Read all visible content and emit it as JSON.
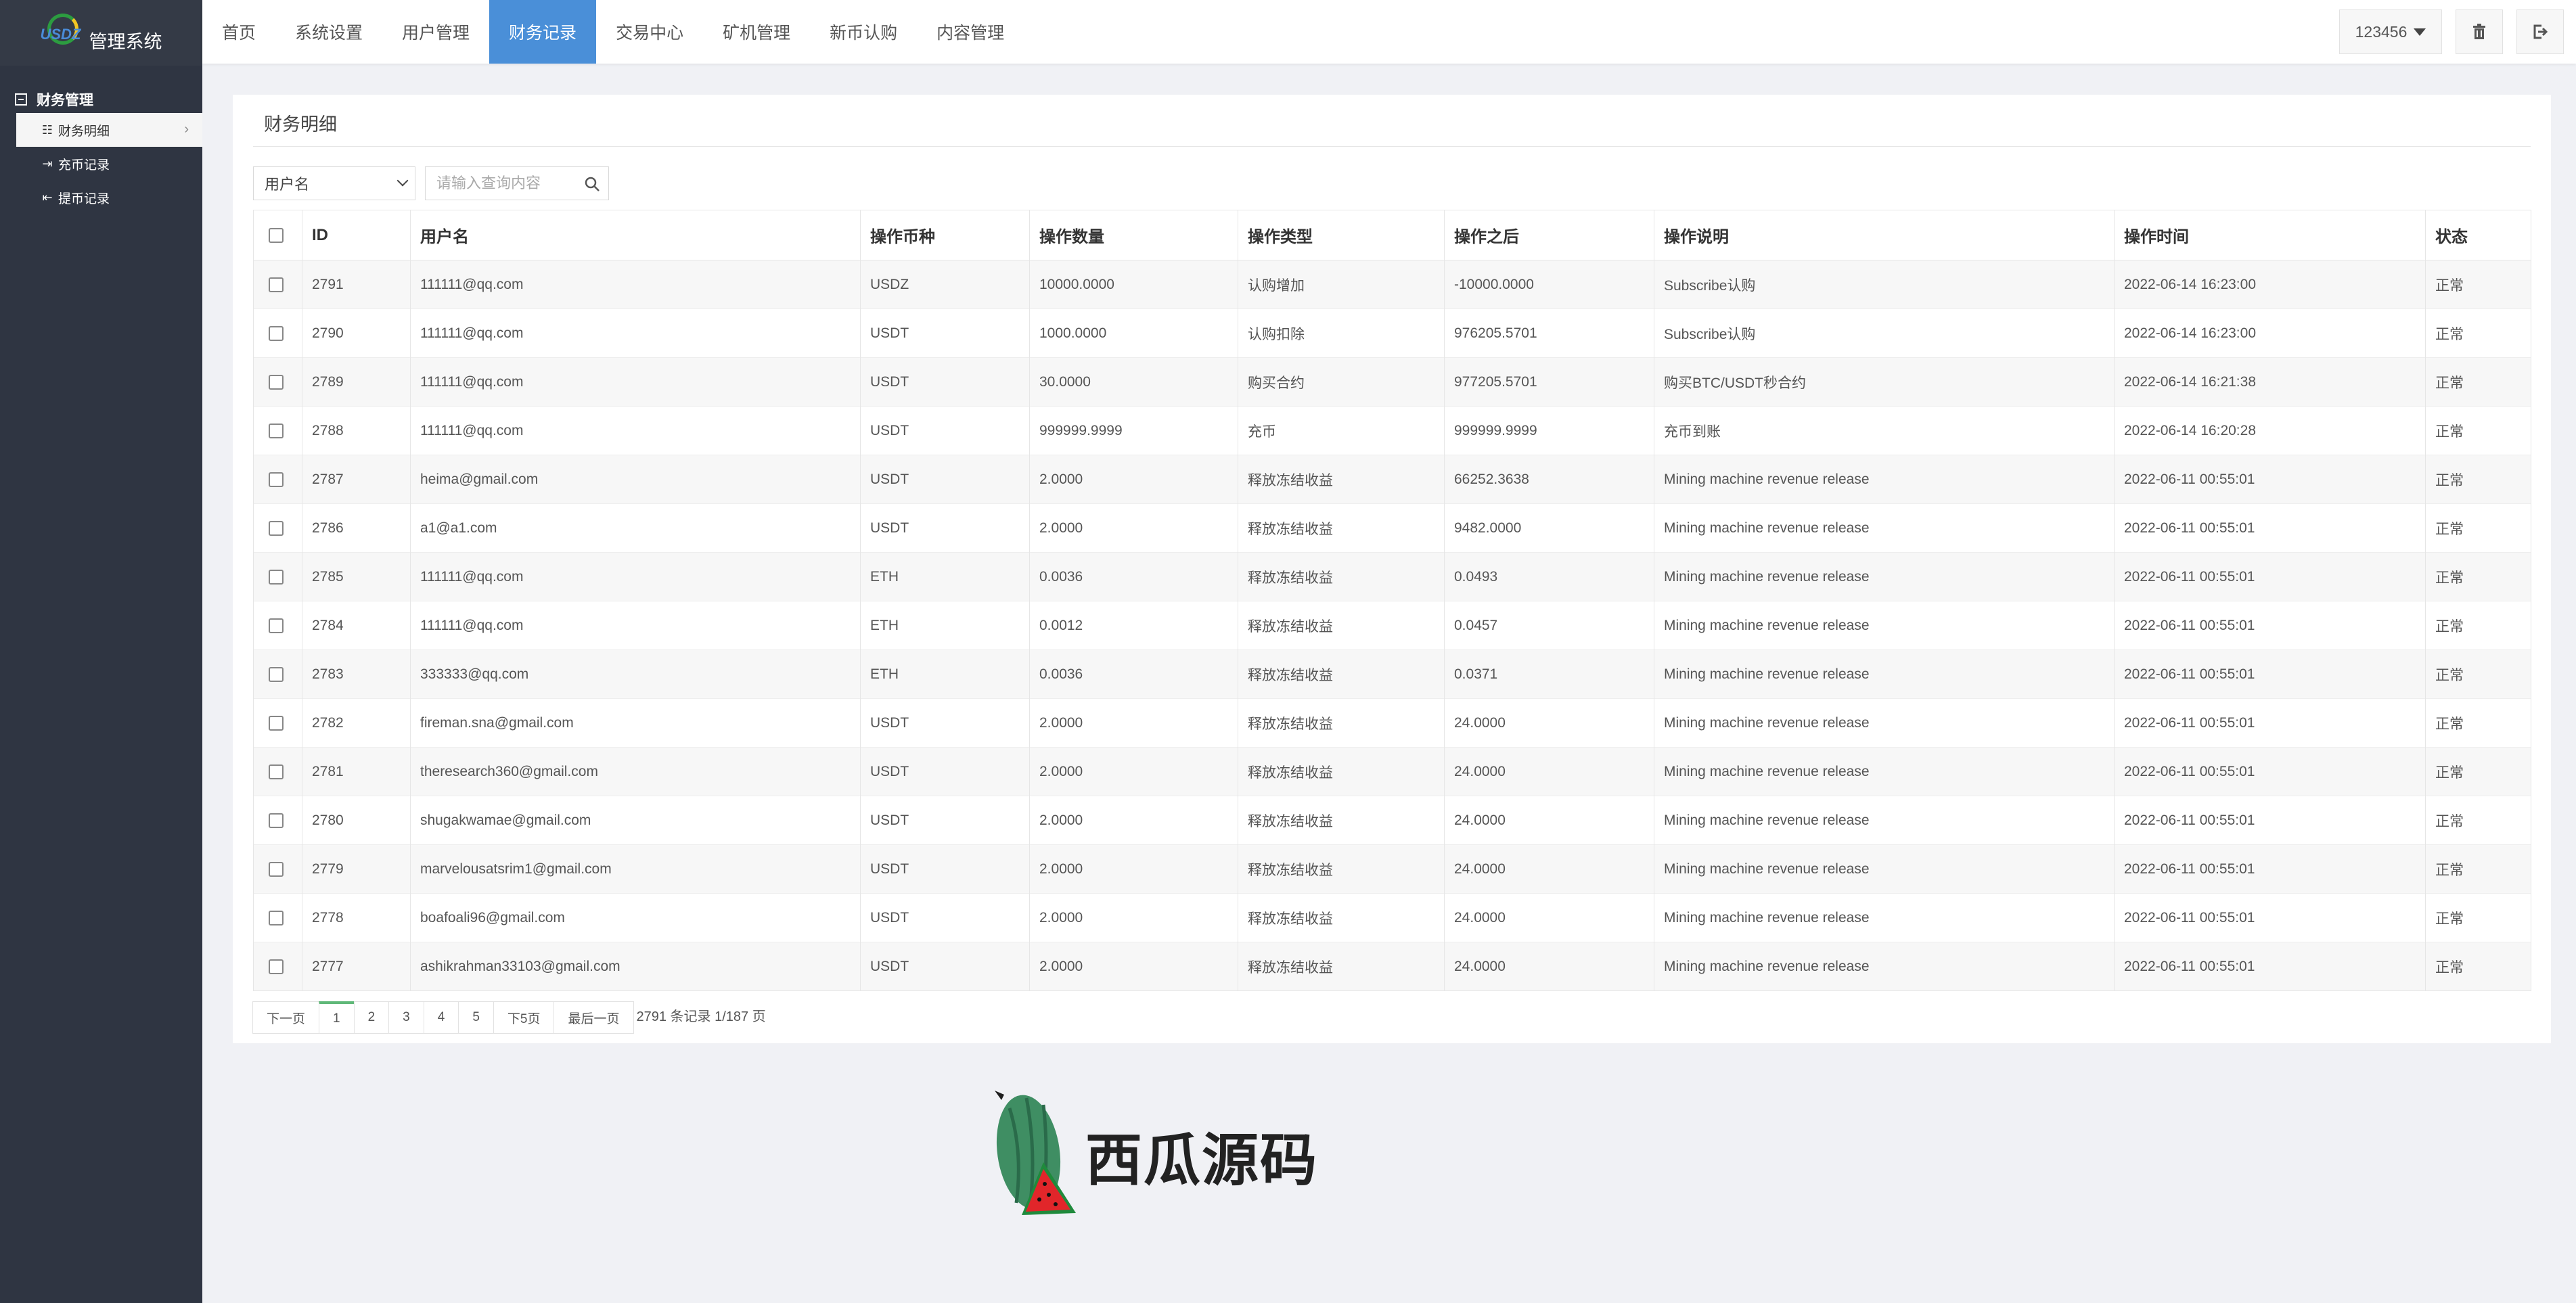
{
  "sidebar": {
    "logo_text": "USDZ",
    "app_title": "管理系统",
    "group_title": "财务管理",
    "items": [
      {
        "label": "财务明细"
      },
      {
        "label": "充币记录"
      },
      {
        "label": "提币记录"
      }
    ]
  },
  "topnav": {
    "items": [
      {
        "label": "首页"
      },
      {
        "label": "系统设置"
      },
      {
        "label": "用户管理"
      },
      {
        "label": "财务记录"
      },
      {
        "label": "交易中心"
      },
      {
        "label": "矿机管理"
      },
      {
        "label": "新币认购"
      },
      {
        "label": "内容管理"
      }
    ],
    "active_index": 3,
    "user_label": "123456"
  },
  "panel": {
    "title": "财务明细",
    "filter_select": "用户名",
    "search_placeholder": "请输入查询内容"
  },
  "table": {
    "columns": [
      "ID",
      "用户名",
      "操作币种",
      "操作数量",
      "操作类型",
      "操作之后",
      "操作说明",
      "操作时间",
      "状态"
    ],
    "rows": [
      {
        "id": "2791",
        "user": "111111@qq.com",
        "coin": "USDZ",
        "amount": "10000.0000",
        "type": "认购增加",
        "after": "-10000.0000",
        "desc": "Subscribe认购",
        "time": "2022-06-14 16:23:00",
        "status": "正常"
      },
      {
        "id": "2790",
        "user": "111111@qq.com",
        "coin": "USDT",
        "amount": "1000.0000",
        "type": "认购扣除",
        "after": "976205.5701",
        "desc": "Subscribe认购",
        "time": "2022-06-14 16:23:00",
        "status": "正常"
      },
      {
        "id": "2789",
        "user": "111111@qq.com",
        "coin": "USDT",
        "amount": "30.0000",
        "type": "购买合约",
        "after": "977205.5701",
        "desc": "购买BTC/USDT秒合约",
        "time": "2022-06-14 16:21:38",
        "status": "正常"
      },
      {
        "id": "2788",
        "user": "111111@qq.com",
        "coin": "USDT",
        "amount": "999999.9999",
        "type": "充币",
        "after": "999999.9999",
        "desc": "充币到账",
        "time": "2022-06-14 16:20:28",
        "status": "正常"
      },
      {
        "id": "2787",
        "user": "heima@gmail.com",
        "coin": "USDT",
        "amount": "2.0000",
        "type": "释放冻结收益",
        "after": "66252.3638",
        "desc": "Mining machine revenue release",
        "time": "2022-06-11 00:55:01",
        "status": "正常"
      },
      {
        "id": "2786",
        "user": "a1@a1.com",
        "coin": "USDT",
        "amount": "2.0000",
        "type": "释放冻结收益",
        "after": "9482.0000",
        "desc": "Mining machine revenue release",
        "time": "2022-06-11 00:55:01",
        "status": "正常"
      },
      {
        "id": "2785",
        "user": "111111@qq.com",
        "coin": "ETH",
        "amount": "0.0036",
        "type": "释放冻结收益",
        "after": "0.0493",
        "desc": "Mining machine revenue release",
        "time": "2022-06-11 00:55:01",
        "status": "正常"
      },
      {
        "id": "2784",
        "user": "111111@qq.com",
        "coin": "ETH",
        "amount": "0.0012",
        "type": "释放冻结收益",
        "after": "0.0457",
        "desc": "Mining machine revenue release",
        "time": "2022-06-11 00:55:01",
        "status": "正常"
      },
      {
        "id": "2783",
        "user": "333333@qq.com",
        "coin": "ETH",
        "amount": "0.0036",
        "type": "释放冻结收益",
        "after": "0.0371",
        "desc": "Mining machine revenue release",
        "time": "2022-06-11 00:55:01",
        "status": "正常"
      },
      {
        "id": "2782",
        "user": "fireman.sna@gmail.com",
        "coin": "USDT",
        "amount": "2.0000",
        "type": "释放冻结收益",
        "after": "24.0000",
        "desc": "Mining machine revenue release",
        "time": "2022-06-11 00:55:01",
        "status": "正常"
      },
      {
        "id": "2781",
        "user": "theresearch360@gmail.com",
        "coin": "USDT",
        "amount": "2.0000",
        "type": "释放冻结收益",
        "after": "24.0000",
        "desc": "Mining machine revenue release",
        "time": "2022-06-11 00:55:01",
        "status": "正常"
      },
      {
        "id": "2780",
        "user": "shugakwamae@gmail.com",
        "coin": "USDT",
        "amount": "2.0000",
        "type": "释放冻结收益",
        "after": "24.0000",
        "desc": "Mining machine revenue release",
        "time": "2022-06-11 00:55:01",
        "status": "正常"
      },
      {
        "id": "2779",
        "user": "marvelousatsrim1@gmail.com",
        "coin": "USDT",
        "amount": "2.0000",
        "type": "释放冻结收益",
        "after": "24.0000",
        "desc": "Mining machine revenue release",
        "time": "2022-06-11 00:55:01",
        "status": "正常"
      },
      {
        "id": "2778",
        "user": "boafoali96@gmail.com",
        "coin": "USDT",
        "amount": "2.0000",
        "type": "释放冻结收益",
        "after": "24.0000",
        "desc": "Mining machine revenue release",
        "time": "2022-06-11 00:55:01",
        "status": "正常"
      },
      {
        "id": "2777",
        "user": "ashikrahman33103@gmail.com",
        "coin": "USDT",
        "amount": "2.0000",
        "type": "释放冻结收益",
        "after": "24.0000",
        "desc": "Mining machine revenue release",
        "time": "2022-06-11 00:55:01",
        "status": "正常"
      }
    ]
  },
  "pager": {
    "prev": "下一页",
    "pages": [
      "1",
      "2",
      "3",
      "4",
      "5"
    ],
    "active_page": "1",
    "next5": "下5页",
    "last": "最后一页",
    "info": "2791 条记录 1/187 页"
  },
  "watermark": {
    "text": "西瓜源码"
  },
  "colors": {
    "sidebar_bg": "#2f3542",
    "nav_active": "#4a8fd8",
    "pager_active": "#5fb878"
  }
}
